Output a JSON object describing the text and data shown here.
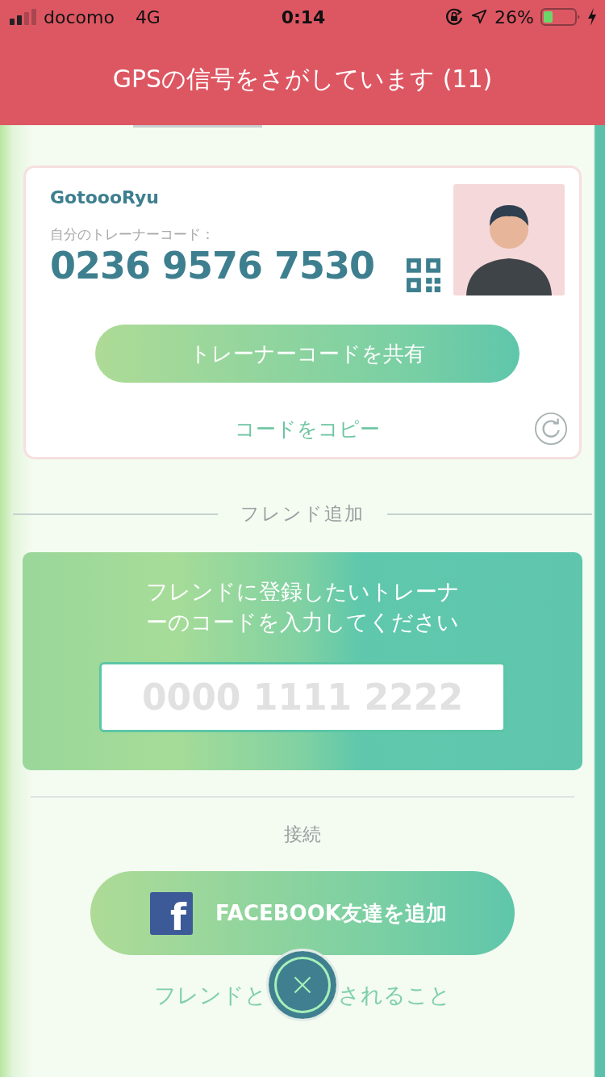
{
  "status_bar": {
    "carrier": "docomo",
    "network": "4G",
    "time": "0:14",
    "battery": "26%"
  },
  "banner": {
    "title": "GPSの信号をさがしています (11)"
  },
  "trainer_card": {
    "name": "GotoooRyu",
    "code_label": "自分のトレーナーコード：",
    "code": "0236 9576 7530",
    "share_button": "トレーナーコードを共有",
    "copy_link": "コードをコピー"
  },
  "add_friend": {
    "heading": "フレンド追加",
    "prompt": "フレンドに登録したいトレーナーのコードを入力してください",
    "code_field": {
      "placeholder": "0000 1111 2222"
    }
  },
  "connect": {
    "heading": "接続",
    "facebook_icon": "f",
    "facebook_button": "FACEBOOK友達を追加",
    "link_parts": [
      "フレンドと",
      "されること"
    ]
  }
}
